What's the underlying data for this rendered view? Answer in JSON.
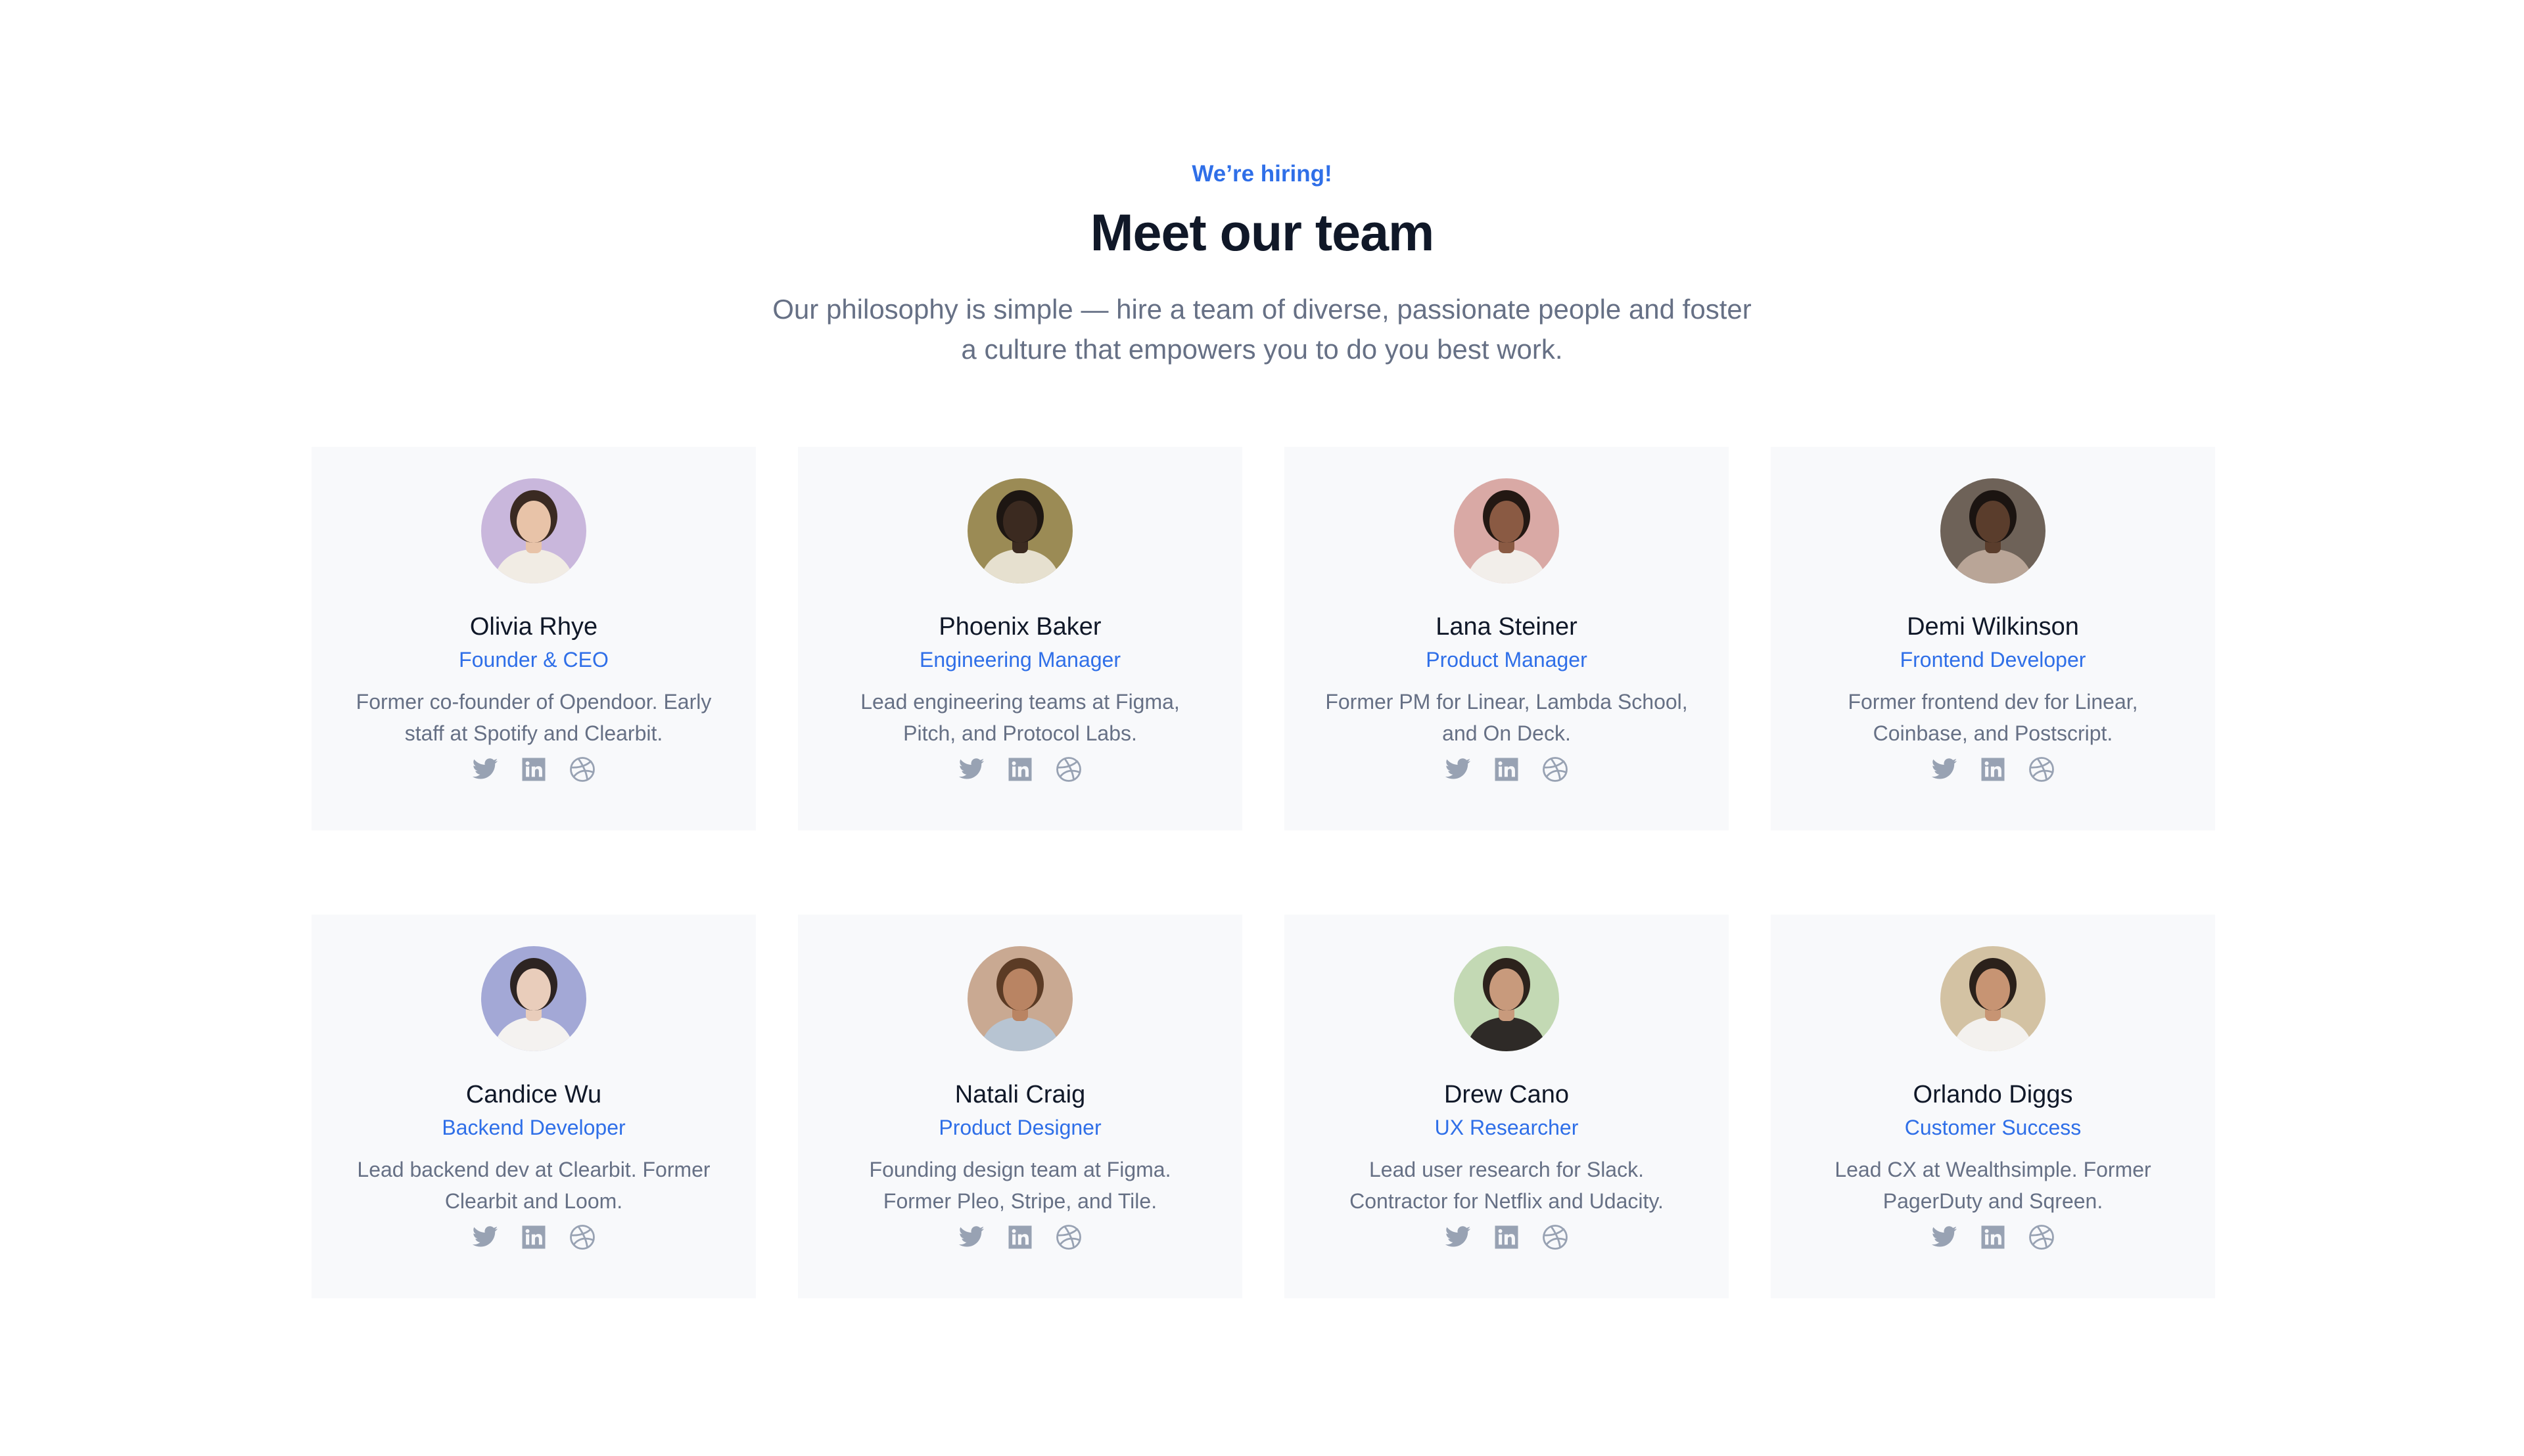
{
  "header": {
    "eyebrow": "We’re hiring!",
    "title": "Meet our team",
    "subtitle_line1": "Our philosophy is simple — hire a team of diverse, passionate people and foster",
    "subtitle_line2": "a culture that empowers you to do you best work."
  },
  "colors": {
    "accent": "#2f6fe8",
    "card_bg": "#f8f9fb",
    "icon": "#98a2b3",
    "body_text": "#667085",
    "heading": "#101828"
  },
  "team": [
    {
      "name": "Olivia Rhye",
      "role": "Founder & CEO",
      "bio_line1": "Former co-founder of Opendoor. Early",
      "bio_line2": "staff at Spotify and Clearbit.",
      "avatar_bg": "#c9b7dc",
      "skin": "#e8c3a8",
      "hair": "#3a2a22",
      "shirt": "#f1ece4"
    },
    {
      "name": "Phoenix Baker",
      "role": "Engineering Manager",
      "bio_line1": "Lead engineering teams at Figma,",
      "bio_line2": "Pitch, and Protocol Labs.",
      "avatar_bg": "#9b8b55",
      "skin": "#3b2a20",
      "hair": "#1d1612",
      "shirt": "#e6e0cf"
    },
    {
      "name": "Lana Steiner",
      "role": "Product Manager",
      "bio_line1": "Former PM for Linear, Lambda School,",
      "bio_line2": "and On Deck.",
      "avatar_bg": "#d9a9a5",
      "skin": "#8a5a43",
      "hair": "#231813",
      "shirt": "#f2eeea"
    },
    {
      "name": "Demi Wilkinson",
      "role": "Frontend Developer",
      "bio_line1": "Former frontend dev for Linear,",
      "bio_line2": "Coinbase, and Postscript.",
      "avatar_bg": "#6e6258",
      "skin": "#5a3d2c",
      "hair": "#1b1411",
      "shirt": "#b9a597"
    },
    {
      "name": "Candice Wu",
      "role": "Backend Developer",
      "bio_line1": "Lead backend dev at Clearbit. Former",
      "bio_line2": "Clearbit and Loom.",
      "avatar_bg": "#a3a8d6",
      "skin": "#e9cdbb",
      "hair": "#2d2422",
      "shirt": "#f4f2f0"
    },
    {
      "name": "Natali Craig",
      "role": "Product Designer",
      "bio_line1": "Founding design team at Figma.",
      "bio_line2": "Former Pleo, Stripe, and Tile.",
      "avatar_bg": "#c9a992",
      "skin": "#b98463",
      "hair": "#5b3b25",
      "shirt": "#b7c4d2"
    },
    {
      "name": "Drew Cano",
      "role": "UX Researcher",
      "bio_line1": "Lead user research for Slack.",
      "bio_line2": "Contractor for Netflix and Udacity.",
      "avatar_bg": "#c3d9b4",
      "skin": "#c89a7c",
      "hair": "#2c221c",
      "shirt": "#2e2a27"
    },
    {
      "name": "Orlando Diggs",
      "role": "Customer Success",
      "bio_line1": "Lead CX at Wealthsimple. Former",
      "bio_line2": "PagerDuty and Sqreen.",
      "avatar_bg": "#d3c2a3",
      "skin": "#c79473",
      "hair": "#2b211b",
      "shirt": "#f3f1ee"
    }
  ],
  "socials": [
    "twitter-icon",
    "linkedin-icon",
    "dribbble-icon"
  ]
}
